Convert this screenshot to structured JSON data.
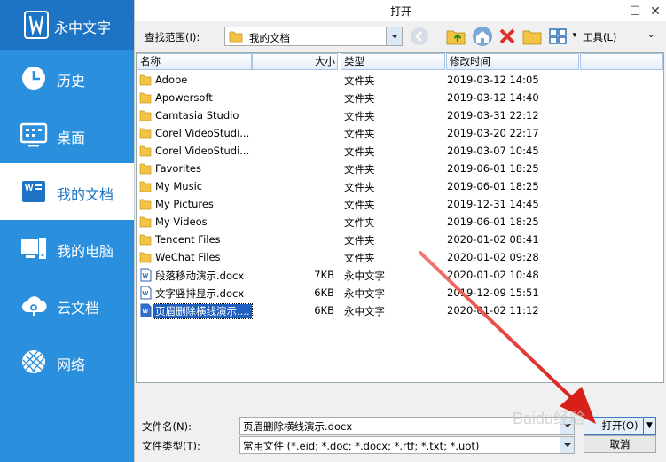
{
  "app": {
    "name": "永中文字"
  },
  "sidebar": {
    "items": [
      {
        "label": "历史",
        "icon": "clock-icon"
      },
      {
        "label": "桌面",
        "icon": "desktop-icon"
      },
      {
        "label": "我的文档",
        "icon": "documents-icon",
        "active": true
      },
      {
        "label": "我的电脑",
        "icon": "computer-icon"
      },
      {
        "label": "云文档",
        "icon": "cloud-icon"
      },
      {
        "label": "网络",
        "icon": "network-icon"
      }
    ]
  },
  "dialog": {
    "title": "打开",
    "lookin_label": "查找范围(I):",
    "lookin_value": "我的文档",
    "tools_label": "工具(L)",
    "columns": {
      "name": "名称",
      "size": "大小",
      "type": "类型",
      "modified": "修改时间"
    },
    "files": [
      {
        "name": "Adobe",
        "size": "",
        "type": "文件夹",
        "modified": "2019-03-12 14:05",
        "kind": "folder"
      },
      {
        "name": "Apowersoft",
        "size": "",
        "type": "文件夹",
        "modified": "2019-03-12 14:40",
        "kind": "folder"
      },
      {
        "name": "Camtasia Studio",
        "size": "",
        "type": "文件夹",
        "modified": "2019-03-31 22:12",
        "kind": "folder"
      },
      {
        "name": "Corel VideoStudi...",
        "size": "",
        "type": "文件夹",
        "modified": "2019-03-20 22:17",
        "kind": "folder"
      },
      {
        "name": "Corel VideoStudi...",
        "size": "",
        "type": "文件夹",
        "modified": "2019-03-07 10:45",
        "kind": "folder"
      },
      {
        "name": "Favorites",
        "size": "",
        "type": "文件夹",
        "modified": "2019-06-01 18:25",
        "kind": "folder"
      },
      {
        "name": "My Music",
        "size": "",
        "type": "文件夹",
        "modified": "2019-06-01 18:25",
        "kind": "folder"
      },
      {
        "name": "My Pictures",
        "size": "",
        "type": "文件夹",
        "modified": "2019-12-31 14:45",
        "kind": "folder"
      },
      {
        "name": "My Videos",
        "size": "",
        "type": "文件夹",
        "modified": "2019-06-01 18:25",
        "kind": "folder"
      },
      {
        "name": "Tencent Files",
        "size": "",
        "type": "文件夹",
        "modified": "2020-01-02 08:41",
        "kind": "folder"
      },
      {
        "name": "WeChat Files",
        "size": "",
        "type": "文件夹",
        "modified": "2020-01-02 09:28",
        "kind": "folder"
      },
      {
        "name": "段落移动演示.docx",
        "size": "7KB",
        "type": "永中文字",
        "modified": "2020-01-02 10:48",
        "kind": "doc"
      },
      {
        "name": "文字竖排显示.docx",
        "size": "6KB",
        "type": "永中文字",
        "modified": "2019-12-09 15:51",
        "kind": "doc"
      },
      {
        "name": "页眉删除横线演示....",
        "size": "6KB",
        "type": "永中文字",
        "modified": "2020-01-02 11:12",
        "kind": "doc",
        "selected": true
      }
    ],
    "filename_label": "文件名(N):",
    "filename_value": "页眉删除横线演示.docx",
    "filetype_label": "文件类型(T):",
    "filetype_value": "常用文件 (*.eid; *.doc; *.docx; *.rtf; *.txt; *.uot)",
    "open_button": "打开(O)",
    "cancel_button": "取消"
  },
  "colors": {
    "sidebar": "#2a8fdd",
    "brand": "#1d74c4",
    "folder": "#f3c443",
    "arrow": "#e0302a"
  },
  "watermark": "Baidu经验"
}
